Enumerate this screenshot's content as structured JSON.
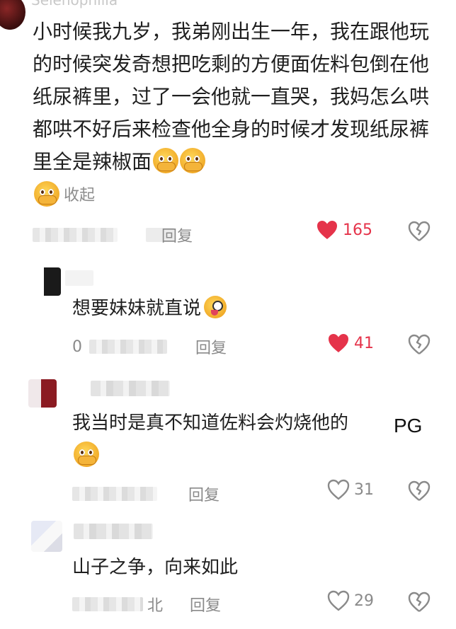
{
  "top_username": "Selenophilia",
  "main_comment": {
    "text": "小时候我九岁，我弟刚出生一年，我在跟他玩的时候突发奇想把吃剩的方便面佐料包倒在他纸尿裤里，过了一会他就一直哭，我妈怎么哄都哄不好后来检查他全身的时候才发现纸尿裤里全是辣椒面",
    "emojis": [
      "crying-face-holding-tears-emoji",
      "crying-face-holding-tears-emoji",
      "crying-face-holding-tears-emoji"
    ],
    "collapse_label": "收起",
    "reply_label": "回复",
    "like_count": "165",
    "liked": true
  },
  "replies": [
    {
      "text": "想要妹妹就直说",
      "emoji": "drooling-face-emoji",
      "date_partial": "0",
      "reply_label": "回复",
      "like_count": "41",
      "liked": true
    },
    {
      "text": "我当时是真不知道佐料会灼烧他的",
      "watermark": "PG",
      "emoji": "crying-face-holding-tears-emoji",
      "reply_label": "回复",
      "like_count": "31",
      "liked": false
    },
    {
      "text": "山子之争，向来如此",
      "location_partial": "北",
      "reply_label": "回复",
      "like_count": "29",
      "liked": false
    }
  ],
  "colors": {
    "like_red": "#e5334a",
    "meta_gray": "#8a8a8a",
    "text": "#1f1f1f"
  }
}
